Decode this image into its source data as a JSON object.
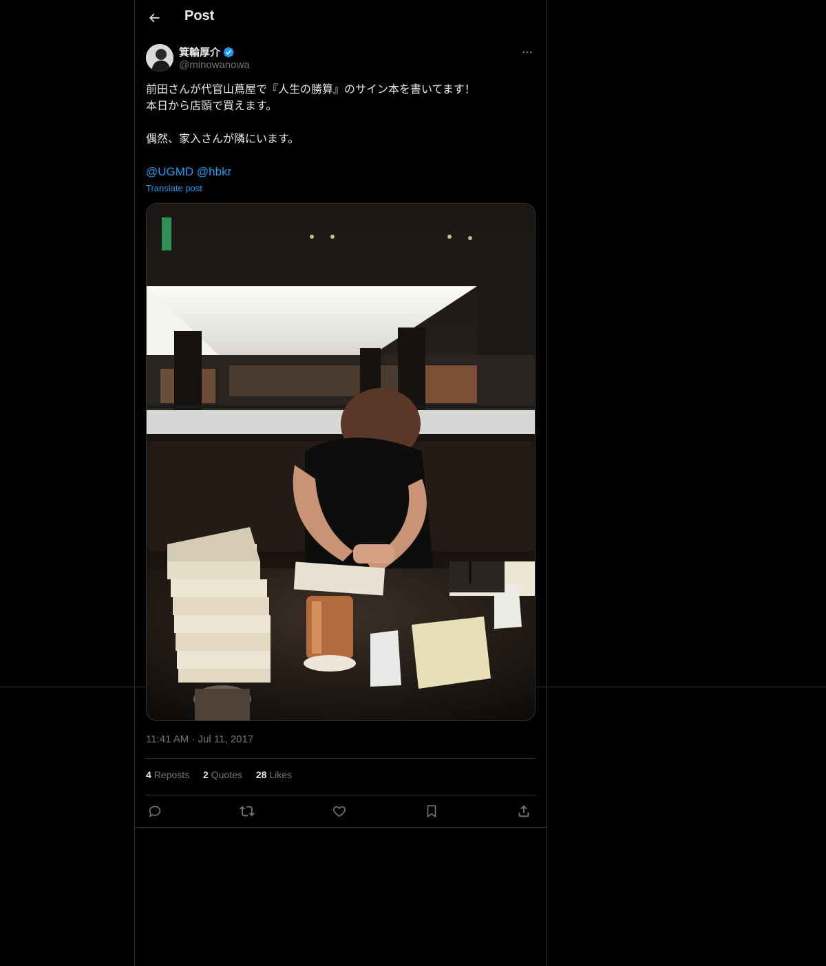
{
  "header": {
    "title": "Post"
  },
  "author": {
    "display_name": "箕輪厚介",
    "handle": "@minowanowa",
    "verified": true
  },
  "post": {
    "lines": [
      "前田さんが代官山蔦屋で『人生の勝算』のサイン本を書いてます！",
      "本日から店頭で買えます。",
      "",
      "偶然、家入さんが隣にいます。",
      ""
    ],
    "mentions": "@UGMD @hbkr",
    "translate_label": "Translate post",
    "timestamp": "11:41 AM · Jul 11, 2017"
  },
  "stats": [
    {
      "count": "4",
      "label": "Reposts"
    },
    {
      "count": "2",
      "label": "Quotes"
    },
    {
      "count": "28",
      "label": "Likes"
    }
  ],
  "icons": [
    "back-arrow-icon",
    "verified-badge-icon",
    "more-icon",
    "reply-icon",
    "repost-icon",
    "like-icon",
    "bookmark-icon",
    "share-icon"
  ],
  "colors": {
    "accent": "#1d9bf0",
    "background": "#000000",
    "text": "#e7e9ea",
    "muted": "#71767b",
    "border": "#2f3336"
  }
}
